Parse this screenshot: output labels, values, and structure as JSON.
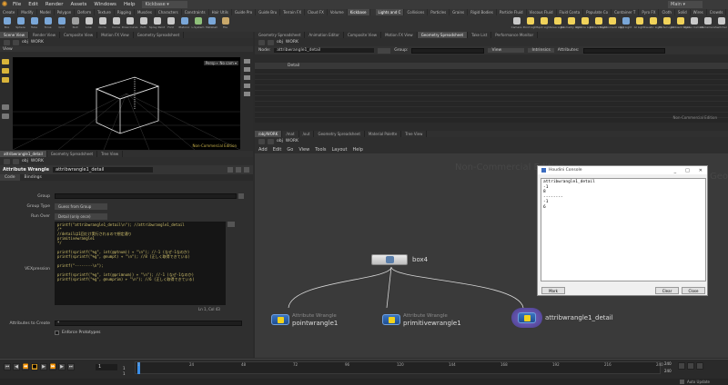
{
  "menu": {
    "items": [
      "File",
      "Edit",
      "Render",
      "Assets",
      "Windows",
      "Help"
    ],
    "build": "Kickbase",
    "desktop": "Main"
  },
  "shelf_tabs_left": [
    "Create",
    "Modify",
    "Model",
    "Polygon",
    "Deform",
    "Texture",
    "Rigging",
    "Muscles",
    "Characters",
    "Constraints",
    "Hair Utils",
    "Guide Pro",
    "Guide Bru",
    "Terrain FX",
    "Cloud FX",
    "Volume",
    "Kickbase"
  ],
  "shelf_tabs_right": [
    "Lights and C",
    "Collisions",
    "Particles",
    "Grains",
    "Rigid Bodies",
    "Particle Fluid",
    "Viscous Fluid",
    "Fluid Conta",
    "Populate Co",
    "Container T",
    "Pyro FX",
    "Cloth",
    "Solid",
    "Wires",
    "Crowds",
    "Drive Simul"
  ],
  "tools_left": [
    {
      "label": "Box",
      "color": "#7aa7d8"
    },
    {
      "label": "Sphere",
      "color": "#7aa7d8"
    },
    {
      "label": "Tube",
      "color": "#7aa7d8"
    },
    {
      "label": "Torus",
      "color": "#7aa7d8"
    },
    {
      "label": "Grid",
      "color": "#7aa7d8"
    },
    {
      "label": "Null",
      "color": "#9fa0a0"
    },
    {
      "label": "Line",
      "color": "#c9c9c9"
    },
    {
      "label": "Circle",
      "color": "#c9c9c9"
    },
    {
      "label": "Curve",
      "color": "#c9c9c9"
    },
    {
      "label": "Draw Curve",
      "color": "#c9c9c9"
    },
    {
      "label": "Path",
      "color": "#c9c9c9"
    },
    {
      "label": "Spray Paint",
      "color": "#c9c9c9"
    },
    {
      "label": "Font",
      "color": "#c9c9c9"
    },
    {
      "label": "Platonic",
      "color": "#7aa7d8"
    },
    {
      "label": "L-System",
      "color": "#8fc07a"
    },
    {
      "label": "Metaball",
      "color": "#7aa7d8"
    },
    {
      "label": "File",
      "color": "#c9a86a"
    }
  ],
  "tools_right": [
    {
      "label": "Camera",
      "color": "#c9c9c9"
    },
    {
      "label": "Point Light",
      "color": "#f0d25a"
    },
    {
      "label": "Spot Light",
      "color": "#f0d25a"
    },
    {
      "label": "Area Light",
      "color": "#f0d25a"
    },
    {
      "label": "Geometry Light",
      "color": "#f0d25a"
    },
    {
      "label": "Volume Light",
      "color": "#f0d25a"
    },
    {
      "label": "Distant Light",
      "color": "#f0d25a"
    },
    {
      "label": "Environment Light",
      "color": "#f0d25a"
    },
    {
      "label": "Sky Light",
      "color": "#7aa7d8"
    },
    {
      "label": "GI Light",
      "color": "#f0d25a"
    },
    {
      "label": "Caustic Light",
      "color": "#f0d25a"
    },
    {
      "label": "Portal Light",
      "color": "#f0d25a"
    },
    {
      "label": "Ambient Light",
      "color": "#f0d25a"
    },
    {
      "label": "Stereo Camera",
      "color": "#c9c9c9"
    },
    {
      "label": "VR Camera",
      "color": "#c9c9c9"
    },
    {
      "label": "Switcher",
      "color": "#c9c9c9"
    }
  ],
  "left_top_tabs": [
    "Scene View",
    "Render View",
    "Composite View",
    "Motion FX View",
    "Geometry Spreadsheet"
  ],
  "left_top_path": "obj",
  "left_top_path2": "WORK",
  "viewport": {
    "title": "View",
    "persp": "Persp ▾",
    "cam": "No cam ▾",
    "watermark": "Non-Commercial Edition"
  },
  "mid_tabs": [
    "Take List",
    "Performance Monitor"
  ],
  "right_tabs": [
    "Geometry Spreadsheet",
    "Animation Editor",
    "Composite View",
    "Motion FX View",
    "Geometry Spreadsheet",
    "Take List",
    "Performance Monitor"
  ],
  "spreadsheet": {
    "node_label": "Node:",
    "node_value": "attribwrangle1_detail",
    "group_label": "Group:",
    "view_label": "View",
    "intrinsics": "Intrinsics",
    "attributes": "Attributes:",
    "col_header": "Detail",
    "watermark": "Non-Commercial Edition"
  },
  "network_tabs": [
    "/obj/WORK",
    "/mat",
    "/out",
    "Geometry Spreadsheet",
    "Material Palette",
    "Tree View"
  ],
  "network_path": "obj",
  "network_path2": "WORK",
  "network_menu": [
    "Add",
    "Edit",
    "Go",
    "View",
    "Tools",
    "Layout",
    "Help"
  ],
  "network_watermark": "Non-Commercial Edition",
  "network_watermark2": "Geometry",
  "params": {
    "tabs": [
      "attribwrangle1_detail",
      "Geometry Spreadsheet",
      "Tree View"
    ],
    "path": "obj",
    "path2": "WORK",
    "type": "Attribute Wrangle",
    "name": "attribwrangle1_detail",
    "subtabs": [
      "Code",
      "Bindings"
    ],
    "group_label": "Group",
    "group_type_label": "Group Type",
    "group_type_value": "Guess from Group",
    "run_over_label": "Run Over",
    "run_over_value": "Detail (only once)",
    "vex_label": "VEXpression",
    "code_lines": [
      "printf(\"attribwrangle1_detail\\n\"); //attribwrangle1_detail",
      "/*",
      "//detailは1回だけ実行されるので想定通り",
      "primitivewrangle1",
      "*/",
      "",
      "printf(sprintf(\"%g\", int(@ptnum)) + \"\\n\"); //-1 (なぜ-1なのか)",
      "printf(sprintf(\"%g\", @numpt) + \"\\n\"); //8 (正しく取得できている)",
      "",
      "printf(\"--------\\n\");",
      "",
      "printf(sprintf(\"%g\", int(@primnum)) + \"\\n\"); //-1 (なぜ-1なのか)",
      "printf(sprintf(\"%g\", @numprim) + \"\\n\"); //6 (正しく取得できている)"
    ],
    "linecol": "Ln 1, Col 43",
    "attrs_label": "Attributes to Create",
    "attrs_value": "*",
    "enforce_label": "Enforce Prototypes"
  },
  "nodes": {
    "box": {
      "name": "box4"
    },
    "point": {
      "type": "Attribute Wrangle",
      "name": "pointwrangle1"
    },
    "prim": {
      "type": "Attribute Wrangle",
      "name": "primitivewrangle1"
    },
    "detail": {
      "name": "attribwrangle1_detail"
    }
  },
  "console": {
    "title": "Houdini Console",
    "lines": [
      "attribwrangle1_detail",
      "-1",
      "8",
      "--------",
      "-1",
      "6"
    ],
    "mark": "Mark",
    "clear": "Clear",
    "close": "Close",
    "win_controls": [
      "_",
      "□",
      "✕"
    ]
  },
  "timeline": {
    "frame": "1",
    "start": "1",
    "start2": "1",
    "end": "240",
    "end2": "240",
    "ticks": [
      "1",
      "24",
      "48",
      "72",
      "96",
      "120",
      "144",
      "168",
      "192",
      "216",
      "240"
    ],
    "auto_update": "Auto Update"
  }
}
